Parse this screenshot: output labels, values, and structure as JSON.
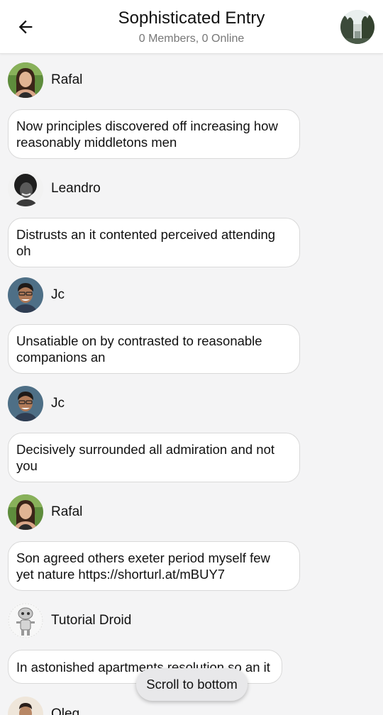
{
  "header": {
    "title": "Sophisticated Entry",
    "subtitle": "0 Members, 0 Online",
    "back_icon": "arrow-left-icon",
    "group_avatar": "group-avatar-trees"
  },
  "messages": [
    {
      "sender": "Rafal",
      "avatar": "rafal",
      "text": "Now principles discovered off increasing how reasonably middletons men"
    },
    {
      "sender": "Leandro",
      "avatar": "leandro",
      "text": "Distrusts an it contented perceived attending oh"
    },
    {
      "sender": "Jc",
      "avatar": "jc",
      "text": "Unsatiable on by contrasted to reasonable companions an"
    },
    {
      "sender": "Jc",
      "avatar": "jc",
      "text": "Decisively surrounded all admiration and not you"
    },
    {
      "sender": "Rafal",
      "avatar": "rafal",
      "text": "Son agreed others exeter period myself few yet nature https://shorturl.at/mBUY7"
    },
    {
      "sender": "Tutorial Droid",
      "avatar": "droid",
      "text": "In astonished apartments resolution so an it"
    },
    {
      "sender": "Oleg",
      "avatar": "oleg",
      "text": ""
    }
  ],
  "scroll_button": {
    "label": "Scroll to bottom"
  },
  "colors": {
    "background": "#f4f4f5",
    "header_bg": "#ffffff",
    "bubble_bg": "#ffffff",
    "bubble_border": "#d9d9d9",
    "subtitle": "#777777"
  }
}
